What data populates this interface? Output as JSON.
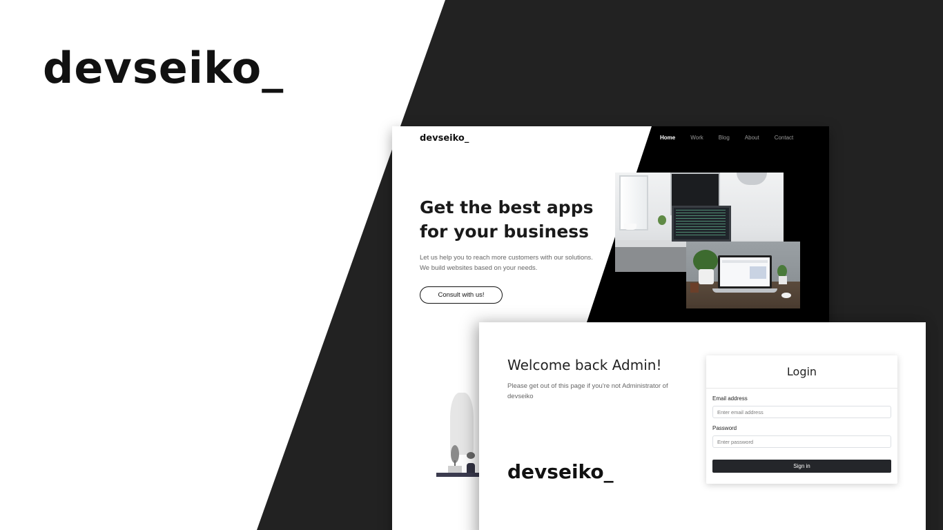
{
  "brand": {
    "title": "devseiko_"
  },
  "landing": {
    "logo": "devseiko_",
    "nav": [
      {
        "label": "Home",
        "active": true
      },
      {
        "label": "Work",
        "active": false
      },
      {
        "label": "Blog",
        "active": false
      },
      {
        "label": "About",
        "active": false
      },
      {
        "label": "Contact",
        "active": false
      }
    ],
    "hero_line1": "Get the best apps",
    "hero_line2": "for your business",
    "hero_sub_line1": "Let us help you to reach more customers with our solutions.",
    "hero_sub_line2": "We build websites based on your needs.",
    "cta_label": "Consult with us!"
  },
  "admin": {
    "welcome_title": "Welcome back Admin!",
    "welcome_sub": "Please get out of this page if you're not Administrator of devseiko",
    "logo": "devseiko_",
    "login": {
      "title": "Login",
      "email_label": "Email address",
      "email_placeholder": "Enter email address",
      "password_label": "Password",
      "password_placeholder": "Enter password",
      "submit_label": "Sign in"
    }
  },
  "colors": {
    "dark_bg": "#222222",
    "landing_dark": "#000000",
    "button_dark": "#24262a"
  }
}
